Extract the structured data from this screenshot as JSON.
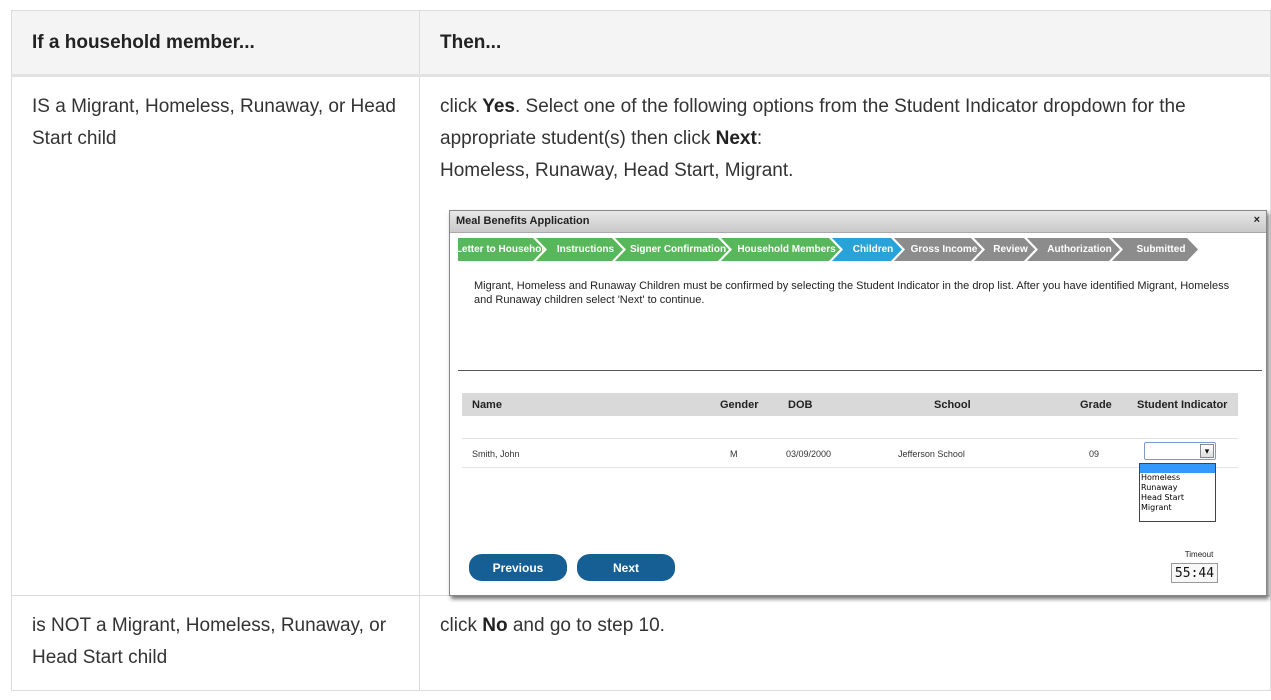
{
  "table": {
    "header": {
      "col1": "If a household member...",
      "col2": "Then..."
    },
    "row1": {
      "condition": "IS a Migrant, Homeless, Runaway, or Head Start child",
      "action_prefix": "click ",
      "action_yes": "Yes",
      "action_mid": ". Select one of the following options from the Student Indicator dropdown for the appropriate student(s) then click ",
      "action_next": "Next",
      "action_suffix": ":",
      "action_options": "Homeless, Runaway, Head Start, Migrant."
    },
    "row2": {
      "condition": "is NOT a Migrant, Homeless, Runaway, or Head Start child",
      "action_prefix": "click ",
      "action_no": "No",
      "action_suffix": " and go to step 10."
    }
  },
  "screenshot": {
    "title": "Meal Benefits Application",
    "close": "×",
    "steps": [
      {
        "label": "Letter to Household",
        "state": "done"
      },
      {
        "label": "Instructions",
        "state": "done"
      },
      {
        "label": "Signer Confirmation",
        "state": "done"
      },
      {
        "label": "Household Members",
        "state": "done"
      },
      {
        "label": "Children",
        "state": "current"
      },
      {
        "label": "Gross Income",
        "state": "todo"
      },
      {
        "label": "Review",
        "state": "todo"
      },
      {
        "label": "Authorization",
        "state": "todo"
      },
      {
        "label": "Submitted",
        "state": "todo"
      }
    ],
    "message": "Migrant, Homeless and Runaway Children must be confirmed by selecting the Student Indicator in the drop list. After you have identified Migrant, Homeless and Runaway children select 'Next' to continue.",
    "grid": {
      "columns": [
        "Name",
        "Gender",
        "DOB",
        "School",
        "Grade",
        "Student Indicator"
      ],
      "row": {
        "name": "Smith, John",
        "gender": "M",
        "dob": "03/09/2000",
        "school": "Jefferson School",
        "grade": "09"
      }
    },
    "dropdown": {
      "selected": "",
      "arrow": "▾",
      "options": [
        "Homeless",
        "Runaway",
        "Head Start",
        "Migrant"
      ]
    },
    "buttons": {
      "previous": "Previous",
      "next": "Next"
    },
    "timeout": {
      "label": "Timeout",
      "value": "55:44"
    },
    "colors": {
      "done": "#59b75b",
      "current": "#27a3d8",
      "todo": "#8c8c8c",
      "button": "#155f94"
    }
  }
}
